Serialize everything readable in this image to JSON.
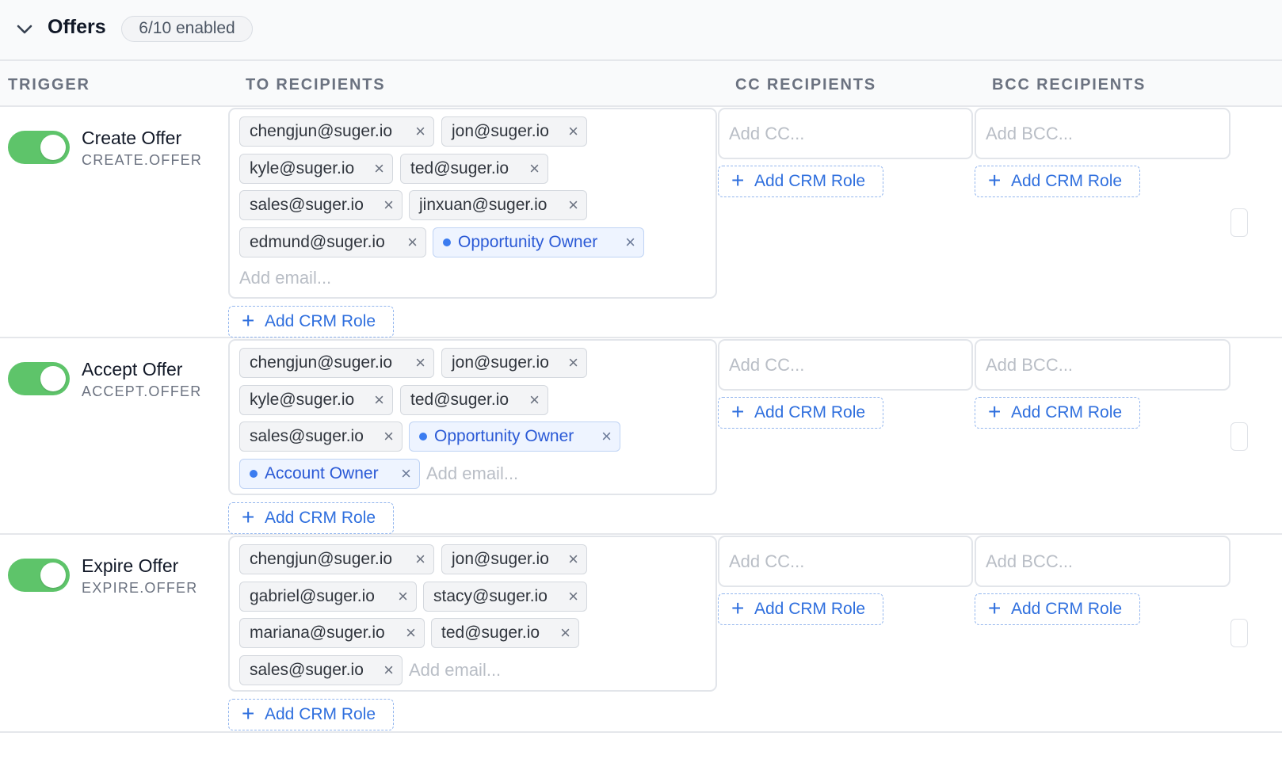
{
  "section": {
    "title": "Offers",
    "badge": "6/10 enabled"
  },
  "columns": {
    "trigger": "TRIGGER",
    "to": "TO RECIPIENTS",
    "cc": "CC RECIPIENTS",
    "bcc": "BCC RECIPIENTS"
  },
  "placeholders": {
    "email": "Add email...",
    "cc": "Add CC...",
    "bcc": "Add BCC..."
  },
  "crm_button_label": "Add CRM Role",
  "colors": {
    "toggle_on": "#5ec46a",
    "accent": "#2f6fde",
    "role_chip_bg": "#eef4ff"
  },
  "rows": [
    {
      "name": "Create Offer",
      "code": "CREATE.OFFER",
      "enabled": true,
      "to": [
        {
          "label": "chengjun@suger.io",
          "type": "email"
        },
        {
          "label": "jon@suger.io",
          "type": "email"
        },
        {
          "label": "kyle@suger.io",
          "type": "email"
        },
        {
          "label": "ted@suger.io",
          "type": "email"
        },
        {
          "label": "sales@suger.io",
          "type": "email"
        },
        {
          "label": "jinxuan@suger.io",
          "type": "email"
        },
        {
          "label": "edmund@suger.io",
          "type": "email"
        },
        {
          "label": "Opportunity Owner",
          "type": "role"
        }
      ]
    },
    {
      "name": "Accept Offer",
      "code": "ACCEPT.OFFER",
      "enabled": true,
      "to": [
        {
          "label": "chengjun@suger.io",
          "type": "email"
        },
        {
          "label": "jon@suger.io",
          "type": "email"
        },
        {
          "label": "kyle@suger.io",
          "type": "email"
        },
        {
          "label": "ted@suger.io",
          "type": "email"
        },
        {
          "label": "sales@suger.io",
          "type": "email"
        },
        {
          "label": "Opportunity Owner",
          "type": "role"
        },
        {
          "label": "Account Owner",
          "type": "role"
        }
      ]
    },
    {
      "name": "Expire Offer",
      "code": "EXPIRE.OFFER",
      "enabled": true,
      "to": [
        {
          "label": "chengjun@suger.io",
          "type": "email"
        },
        {
          "label": "jon@suger.io",
          "type": "email"
        },
        {
          "label": "gabriel@suger.io",
          "type": "email"
        },
        {
          "label": "stacy@suger.io",
          "type": "email"
        },
        {
          "label": "mariana@suger.io",
          "type": "email"
        },
        {
          "label": "ted@suger.io",
          "type": "email"
        },
        {
          "label": "sales@suger.io",
          "type": "email"
        }
      ]
    }
  ]
}
